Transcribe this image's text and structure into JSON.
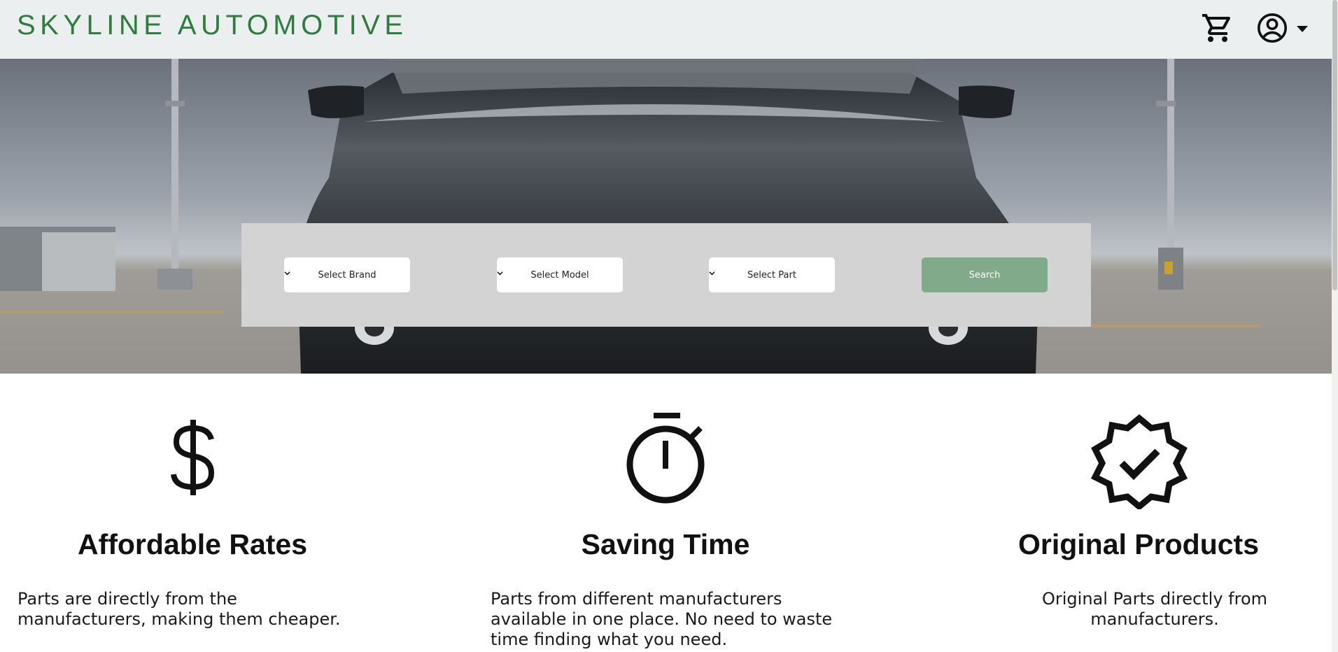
{
  "header": {
    "brand": "SKYLINE AUTOMOTIVE",
    "brand_color": "#2e7d3c",
    "cart_icon": "cart-icon",
    "account_icon": "account-circle-icon",
    "dropdown_icon": "caret-down-icon"
  },
  "search": {
    "brand_select": "Select Brand",
    "model_select": "Select Model",
    "part_select": "Select Part",
    "button": "Search",
    "button_color": "#80aa8a"
  },
  "features": [
    {
      "icon": "dollar-icon",
      "title": "Affordable Rates",
      "text": "Parts are directly from the manufacturers, making them cheaper."
    },
    {
      "icon": "stopwatch-icon",
      "title": "Saving Time",
      "text": "Parts from different manufacturers available in one place. No need to waste time finding what you need."
    },
    {
      "icon": "verified-badge-icon",
      "title": "Original Products",
      "text": "Original Parts directly from manufacturers."
    }
  ]
}
